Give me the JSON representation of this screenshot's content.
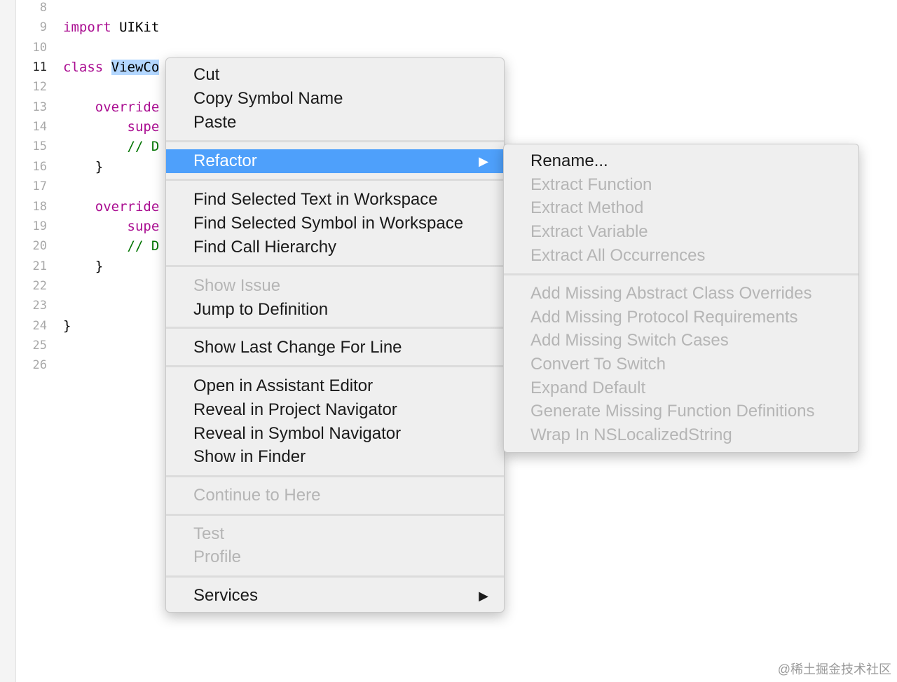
{
  "editor": {
    "lines": [
      {
        "num": "8",
        "tokens": []
      },
      {
        "num": "9",
        "tokens": [
          {
            "t": "import",
            "c": "kw"
          },
          {
            "t": " UIKit",
            "c": ""
          }
        ]
      },
      {
        "num": "10",
        "tokens": []
      },
      {
        "num": "11",
        "tokens": [
          {
            "t": "class",
            "c": "kw"
          },
          {
            "t": " ",
            "c": ""
          },
          {
            "t": "ViewCo",
            "c": "sel"
          }
        ]
      },
      {
        "num": "12",
        "tokens": []
      },
      {
        "num": "13",
        "tokens": [
          {
            "t": "    override",
            "c": "kw"
          }
        ]
      },
      {
        "num": "14",
        "tokens": [
          {
            "t": "        supe",
            "c": "kw"
          }
        ]
      },
      {
        "num": "15",
        "tokens": [
          {
            "t": "        // D",
            "c": "cm"
          }
        ]
      },
      {
        "num": "16",
        "tokens": [
          {
            "t": "    }",
            "c": ""
          }
        ]
      },
      {
        "num": "17",
        "tokens": []
      },
      {
        "num": "18",
        "tokens": [
          {
            "t": "    override",
            "c": "kw"
          }
        ]
      },
      {
        "num": "19",
        "tokens": [
          {
            "t": "        supe",
            "c": "kw"
          }
        ]
      },
      {
        "num": "20",
        "tokens": [
          {
            "t": "        // D",
            "c": "cm"
          }
        ]
      },
      {
        "num": "21",
        "tokens": [
          {
            "t": "    }",
            "c": ""
          }
        ]
      },
      {
        "num": "22",
        "tokens": []
      },
      {
        "num": "23",
        "tokens": []
      },
      {
        "num": "24",
        "tokens": [
          {
            "t": "}",
            "c": ""
          }
        ]
      },
      {
        "num": "25",
        "tokens": []
      },
      {
        "num": "26",
        "tokens": []
      }
    ],
    "current_line": "11"
  },
  "context_menu": {
    "items": {
      "cut": "Cut",
      "copy_symbol_name": "Copy Symbol Name",
      "paste": "Paste",
      "refactor": "Refactor",
      "find_selected_text": "Find Selected Text in Workspace",
      "find_selected_symbol": "Find Selected Symbol in Workspace",
      "find_call_hierarchy": "Find Call Hierarchy",
      "show_issue": "Show Issue",
      "jump_to_definition": "Jump to Definition",
      "show_last_change": "Show Last Change For Line",
      "open_assistant": "Open in Assistant Editor",
      "reveal_project": "Reveal in Project Navigator",
      "reveal_symbol": "Reveal in Symbol Navigator",
      "show_in_finder": "Show in Finder",
      "continue_to_here": "Continue to Here",
      "test": "Test",
      "profile": "Profile",
      "services": "Services"
    },
    "submenu_arrow": "▶"
  },
  "refactor_submenu": {
    "items": {
      "rename": "Rename...",
      "extract_function": "Extract Function",
      "extract_method": "Extract Method",
      "extract_variable": "Extract Variable",
      "extract_all": "Extract All Occurrences",
      "add_abstract_overrides": "Add Missing Abstract Class Overrides",
      "add_protocol_requirements": "Add Missing Protocol Requirements",
      "add_switch_cases": "Add Missing Switch Cases",
      "convert_to_switch": "Convert To Switch",
      "expand_default": "Expand Default",
      "generate_function_defs": "Generate Missing Function Definitions",
      "wrap_nslocalized": "Wrap In NSLocalizedString"
    }
  },
  "watermark": "@稀土掘金技术社区",
  "colors": {
    "highlight": "#4ea0fb",
    "keyword": "#aa0d91",
    "comment": "#007400",
    "selection": "#b3d7ff"
  }
}
